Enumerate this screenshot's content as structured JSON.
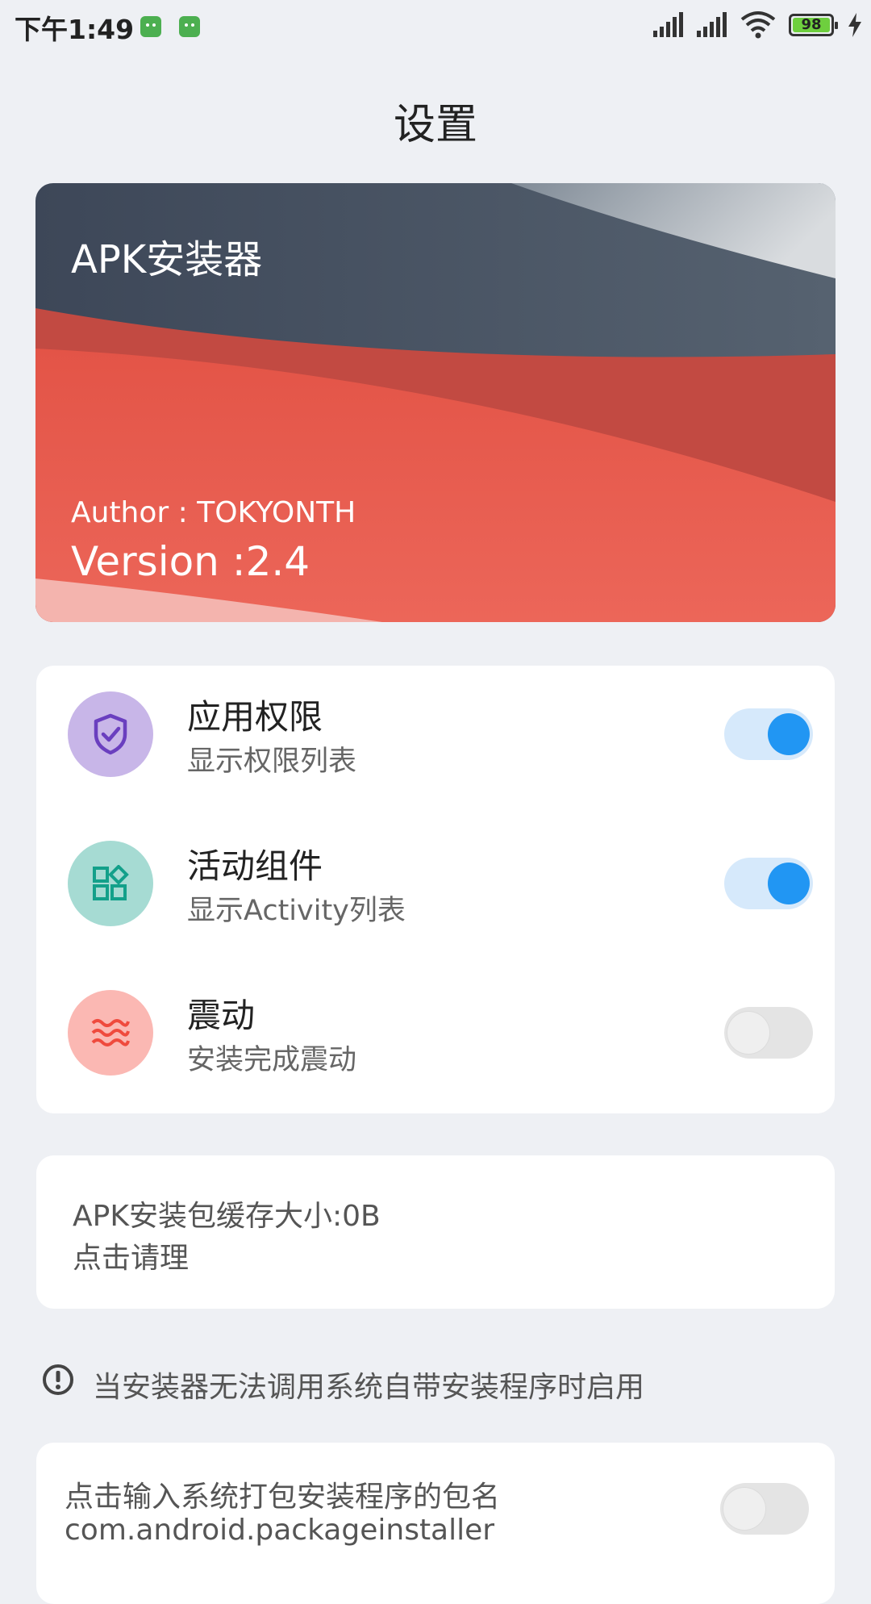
{
  "status_bar": {
    "time": "下午1:49",
    "battery": "98",
    "icons": [
      "notification-app-icon",
      "notification-app-icon",
      "signal-icon",
      "signal-icon",
      "wifi-icon",
      "battery-icon",
      "charging-icon"
    ]
  },
  "header": {
    "title": "设置"
  },
  "banner": {
    "app_name": "APK安装器",
    "author": "Author : TOKYONTH",
    "version": "Version :2.4"
  },
  "settings": [
    {
      "title": "应用权限",
      "subtitle": "显示权限列表",
      "icon": "shield-check-icon",
      "enabled": true,
      "icon_bg": "#c8b6e8",
      "icon_color": "#6a3fbf"
    },
    {
      "title": "活动组件",
      "subtitle": "显示Activity列表",
      "icon": "widgets-icon",
      "enabled": true,
      "icon_bg": "#a6dbd3",
      "icon_color": "#13a08a"
    },
    {
      "title": "震动",
      "subtitle": "安装完成震动",
      "icon": "vibration-waves-icon",
      "enabled": false,
      "icon_bg": "#fbb8b3",
      "icon_color": "#ef4a3d"
    }
  ],
  "cache": {
    "line1": "APK安装包缓存大小:0B",
    "line2": "点击请理"
  },
  "note": {
    "text": "当安装器无法调用系统自带安装程序时启用",
    "icon": "info-exclamation-icon"
  },
  "package": {
    "line1": "点击输入系统打包安装程序的包名",
    "line2": "com.android.packageinstaller",
    "enabled": false
  },
  "colors": {
    "accent": "#2196f3",
    "banner_red": "#e8554a",
    "banner_dark": "#3e4a5c",
    "background": "#eef0f4"
  }
}
